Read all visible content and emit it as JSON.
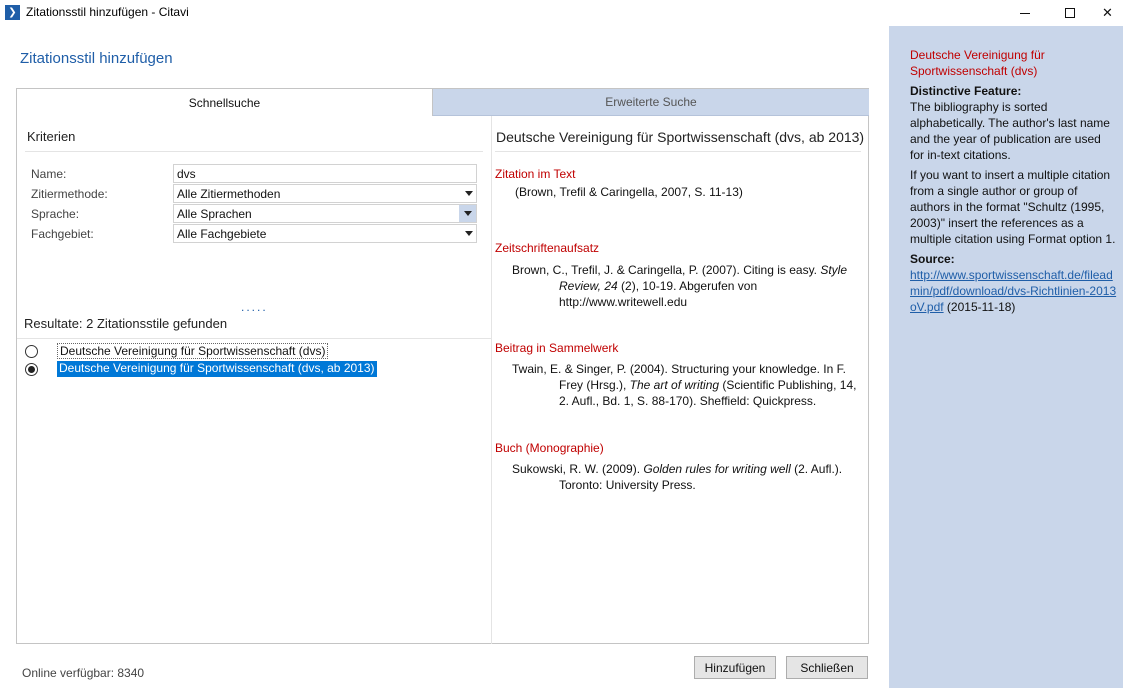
{
  "window": {
    "title": "Zitationsstil hinzufügen - Citavi",
    "app_icon": "\u0012"
  },
  "dialog": {
    "heading": "Zitationsstil hinzufügen"
  },
  "tabs": [
    {
      "label": "Schnellsuche",
      "active": true
    },
    {
      "label": "Erweiterte Suche",
      "active": false
    }
  ],
  "criteria": {
    "title": "Kriterien",
    "name_label": "Name:",
    "name_value": "dvs",
    "method_label": "Zitiermethode:",
    "method_value": "Alle Zitiermethoden",
    "language_label": "Sprache:",
    "language_value": "Alle Sprachen",
    "field_label": "Fachgebiet:",
    "field_value": "Alle Fachgebiete"
  },
  "results": {
    "splitter_dots": ".....",
    "label": "Resultate: 2 Zitationsstile gefunden",
    "items": [
      {
        "label": "Deutsche Vereinigung für Sportwissenschaft (dvs)",
        "selected": false
      },
      {
        "label": "Deutsche Vereinigung für Sportwissenschaft (dvs, ab 2013)",
        "selected": true
      }
    ]
  },
  "preview": {
    "title": "Deutsche Vereinigung für Sportwissenschaft (dvs, ab 2013)",
    "sections": [
      {
        "title": "Zitation im Text",
        "text": "(Brown, Trefil & Caringella, 2007, S. 11-13)"
      },
      {
        "title": "Zeitschriftenaufsatz",
        "text_pre": "Brown, C., Trefil, J. & Caringella, P. (2007). Citing is easy. ",
        "text_italic": "Style Review, 24",
        "text_post": " (2), 10-19. Abgerufen von http://www.writewell.edu"
      },
      {
        "title": "Beitrag in Sammelwerk",
        "text_pre": "Twain, E. & Singer, P. (2004). Structuring your knowledge. In F. Frey (Hrsg.), ",
        "text_italic": "The art of writing",
        "text_post": " (Scientific Publishing, 14, 2. Aufl., Bd. 1, S. 88-170). Sheffield: Quickpress."
      },
      {
        "title": "Buch (Monographie)",
        "text_pre": "Sukowski, R. W. (2009). ",
        "text_italic": "Golden rules for writing well",
        "text_post": " (2. Aufl.). Toronto: University Press."
      }
    ]
  },
  "footer": {
    "online_text": "Online verfügbar: 8340",
    "add_button": "Hinzufügen",
    "close_button": "Schließen"
  },
  "info": {
    "title": "Deutsche Vereinigung für Sportwissenschaft (dvs)",
    "feature_heading": "Distinctive Feature:",
    "feature_text": "The bibliography is sorted alphabetically. The author's last name and the year of publication are used for in-text citations.",
    "multi_text": "If you want to insert a multiple citation from a single author or group of authors in the format \"Schultz (1995, 2003)\" insert the references as a multiple citation using Format option 1.",
    "source_heading": "Source:",
    "source_link": "http://www.sportwissenschaft.de/fileadmin/pdf/download/dvs-Richtlinien-2013oV.pdf",
    "source_date": " (2015-11-18)"
  },
  "colors": {
    "accent": "#1f5ea8",
    "section_red": "#c00000",
    "selection": "#0078d7",
    "panel_blue": "#c9d6ea"
  },
  "icons": {
    "app": "citavi-app-icon",
    "minimize": "minimize-icon",
    "maximize": "maximize-icon",
    "close": "close-icon"
  }
}
